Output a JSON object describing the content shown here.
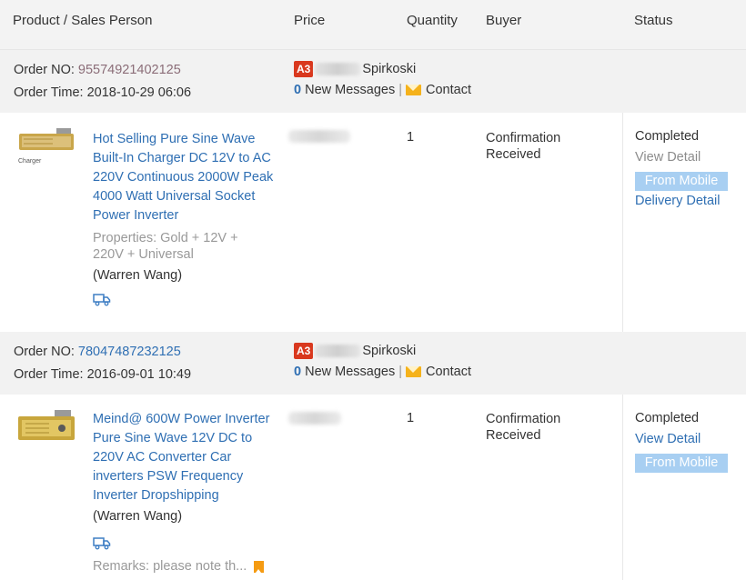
{
  "header": {
    "product": "Product / Sales Person",
    "price": "Price",
    "quantity": "Quantity",
    "buyer": "Buyer",
    "status": "Status"
  },
  "orders": [
    {
      "order_no_label": "Order NO: ",
      "order_no": "95574921402125",
      "order_time_label": "Order Time: ",
      "order_time": "2018-10-29 06:06",
      "seller_badge": "A3",
      "seller_name": "Spirkoski",
      "messages_count": "0",
      "messages_label": " New Messages",
      "separator": "|",
      "contact_label": "Contact",
      "product_title": "Hot Selling Pure Sine Wave Built-In Charger DC 12V to AC 220V Continuous 2000W Peak 4000 Watt Universal Socket Power Inverter",
      "properties": "Properties: Gold + 12V + 220V + Universal",
      "sales_person": "(Warren Wang)",
      "thumb_caption": "Charger",
      "quantity": "1",
      "buyer_status": "Confirmation Received",
      "status": "Completed",
      "view_detail": "View Detail",
      "mobile_badge": "From Mobile",
      "delivery_detail": "Delivery Detail"
    },
    {
      "order_no_label": "Order NO: ",
      "order_no": "78047487232125",
      "order_time_label": "Order Time: ",
      "order_time": "2016-09-01 10:49",
      "seller_badge": "A3",
      "seller_name": "Spirkoski",
      "messages_count": "0",
      "messages_label": " New Messages",
      "separator": "|",
      "contact_label": "Contact",
      "product_title": "Meind@ 600W Power Inverter Pure Sine Wave 12V DC to 220V AC Converter Car inverters PSW Frequency Inverter Dropshipping",
      "sales_person": "(Warren Wang)",
      "remarks": "Remarks: please note th...",
      "quantity": "1",
      "buyer_status": "Confirmation Received",
      "status": "Completed",
      "view_detail": "View Detail",
      "mobile_badge": "From Mobile"
    }
  ],
  "icons": {
    "mail": "mail-icon",
    "truck": "truck-icon",
    "bookmark": "bookmark-icon"
  },
  "colors": {
    "link": "#2f6fb3",
    "badge_red": "#d9381e",
    "mobile_badge": "#a8cff2",
    "mail": "#f5b21b"
  }
}
